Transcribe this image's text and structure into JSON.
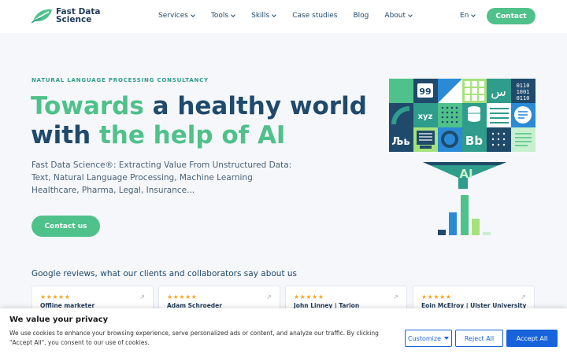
{
  "brand": {
    "name_line1": "Fast Data",
    "name_line2": "Science"
  },
  "nav": {
    "items": [
      {
        "label": "Services",
        "has_dropdown": true
      },
      {
        "label": "Tools",
        "has_dropdown": true
      },
      {
        "label": "Skills",
        "has_dropdown": true
      },
      {
        "label": "Case studies",
        "has_dropdown": false
      },
      {
        "label": "Blog",
        "has_dropdown": false
      },
      {
        "label": "About",
        "has_dropdown": true
      }
    ],
    "language": "En",
    "contact_label": "Contact"
  },
  "hero": {
    "eyebrow": "NATURAL LANGUAGE PROCESSING CONSULTANCY",
    "headline_part1": "Towards",
    "headline_part2": " a healthy world",
    "headline_part3": "with ",
    "headline_part4": "the help of AI",
    "subtitle": "Fast Data Science®: Extracting Value From Unstructured Data: Text, Natural Language Processing, Machine Learning Healthcare, Pharma, Legal, Insurance...",
    "cta_label": "Contact us",
    "illustration_text": {
      "quote": "99",
      "arabic": "س",
      "binary1": "0110",
      "binary2": "1001",
      "binary3": "0110",
      "xyz": "xyz",
      "cyrillic": "Љь",
      "bb": "Bb",
      "funnel": "AI"
    }
  },
  "reviews": {
    "title": "Google reviews, what our clients and collaborators say about us",
    "stars": "★★★★★",
    "cards": [
      {
        "reviewer": "Offline marketer"
      },
      {
        "reviewer": "Adam Schroeder"
      },
      {
        "reviewer": "John Linney | Tarion"
      },
      {
        "reviewer": "Eoin McElroy | Ulster University"
      }
    ]
  },
  "cookie": {
    "title": "We value your privacy",
    "text": "We use cookies to enhance your browsing experience, serve personalized ads or content, and analyze our traffic. By clicking \"Accept All\", you consent to our use of cookies.",
    "customize_label": "Customize",
    "reject_label": "Reject All",
    "accept_label": "Accept All"
  },
  "colors": {
    "brand_green": "#4fc18a",
    "brand_navy": "#1f4a6b",
    "teal": "#2f9c8c",
    "cookie_blue": "#1863dc"
  }
}
